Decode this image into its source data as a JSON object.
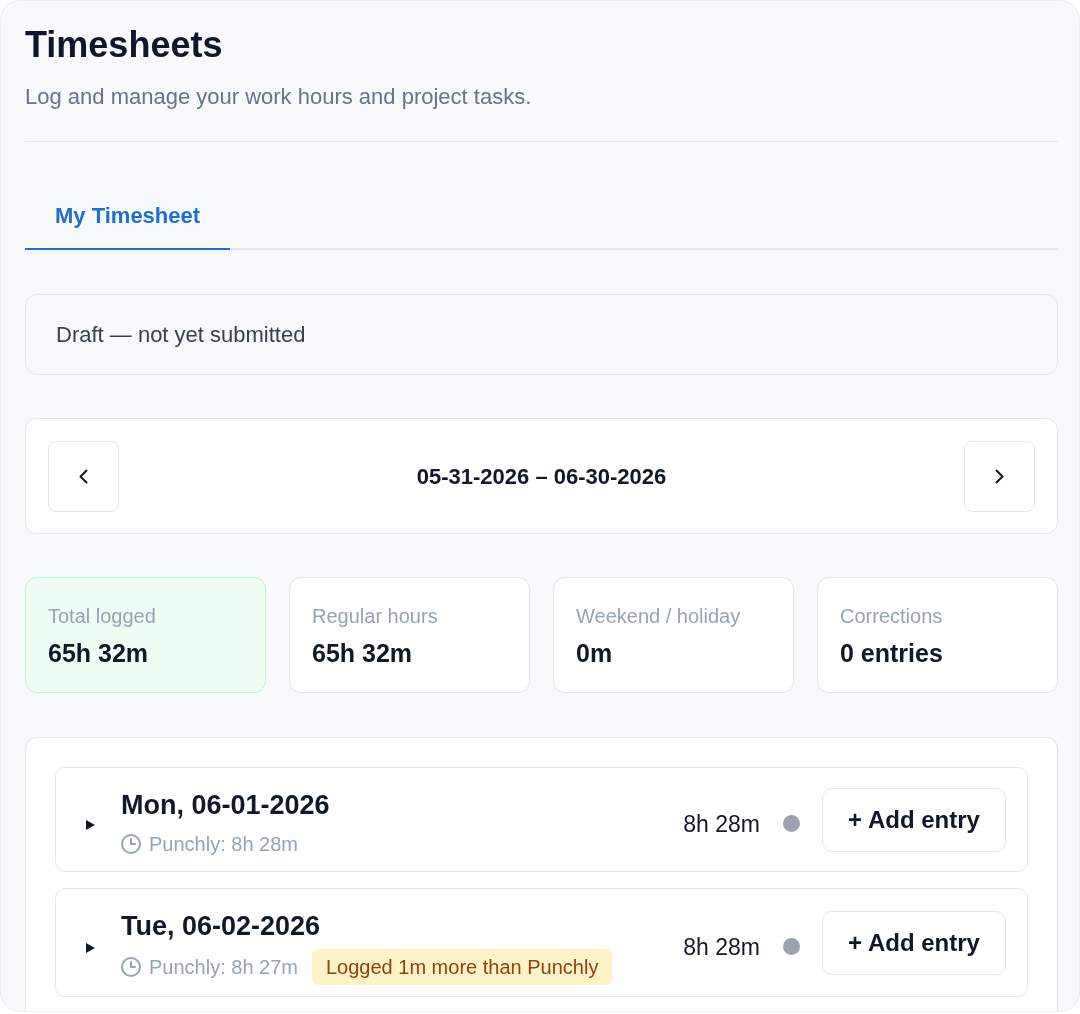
{
  "header": {
    "title": "Timesheets",
    "subtitle": "Log and manage your work hours and project tasks."
  },
  "tabs": [
    {
      "label": "My Timesheet",
      "selected": true
    }
  ],
  "status_banner": {
    "text": "Draft — not yet submitted"
  },
  "date_range": {
    "label": "05-31-2026 – 06-30-2026"
  },
  "stats": [
    {
      "label": "Total logged",
      "value": "65h 32m",
      "highlighted": true
    },
    {
      "label": "Regular hours",
      "value": "65h 32m",
      "highlighted": false
    },
    {
      "label": "Weekend / holiday",
      "value": "0m",
      "highlighted": false
    },
    {
      "label": "Corrections",
      "value": "0 entries",
      "highlighted": false
    }
  ],
  "days": [
    {
      "date": "Mon, 06-01-2026",
      "expanded": false,
      "punchly": "Punchly: 8h 28m",
      "logged": "8h 28m",
      "color": "#9ca3af",
      "add_button": "+ Add entry"
    },
    {
      "date": "Tue, 06-02-2026",
      "expanded": false,
      "punchly": "Punchly: 8h 27m",
      "badge": "Logged 1m more than Punchly",
      "logged": "8h 28m",
      "color": "#9ca3af",
      "add_button": "+ Add entry"
    }
  ]
}
